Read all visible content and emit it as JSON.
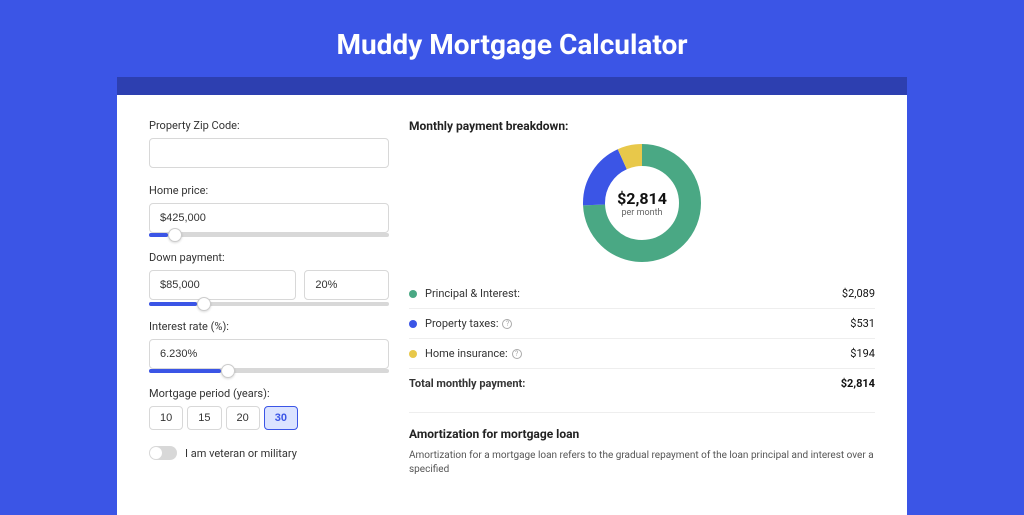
{
  "title": "Muddy Mortgage Calculator",
  "colors": {
    "green": "#4aa884",
    "blue": "#3b55e6",
    "yellow": "#e8c84a"
  },
  "form": {
    "zip": {
      "label": "Property Zip Code:",
      "value": ""
    },
    "homePrice": {
      "label": "Home price:",
      "value": "$425,000",
      "sliderPct": 8
    },
    "downPayment": {
      "label": "Down payment:",
      "amount": "$85,000",
      "percent": "20%",
      "sliderPct": 20
    },
    "interest": {
      "label": "Interest rate (%):",
      "value": "6.230%",
      "sliderPct": 30
    },
    "period": {
      "label": "Mortgage period (years):",
      "options": [
        "10",
        "15",
        "20",
        "30"
      ],
      "active": "30"
    },
    "veteran": {
      "label": "I am veteran or military"
    }
  },
  "breakdown": {
    "title": "Monthly payment breakdown:",
    "centerAmount": "$2,814",
    "centerSub": "per month",
    "items": [
      {
        "label": "Principal & Interest:",
        "value": "$2,089",
        "color": "green",
        "info": false
      },
      {
        "label": "Property taxes:",
        "value": "$531",
        "color": "blue",
        "info": true
      },
      {
        "label": "Home insurance:",
        "value": "$194",
        "color": "yellow",
        "info": true
      }
    ],
    "totalLabel": "Total monthly payment:",
    "totalValue": "$2,814"
  },
  "chart_data": {
    "type": "pie",
    "title": "Monthly payment breakdown",
    "categories": [
      "Principal & Interest",
      "Property taxes",
      "Home insurance"
    ],
    "values": [
      2089,
      531,
      194
    ],
    "total": 2814,
    "colors": [
      "#4aa884",
      "#3b55e6",
      "#e8c84a"
    ]
  },
  "amortization": {
    "title": "Amortization for mortgage loan",
    "text": "Amortization for a mortgage loan refers to the gradual repayment of the loan principal and interest over a specified"
  }
}
